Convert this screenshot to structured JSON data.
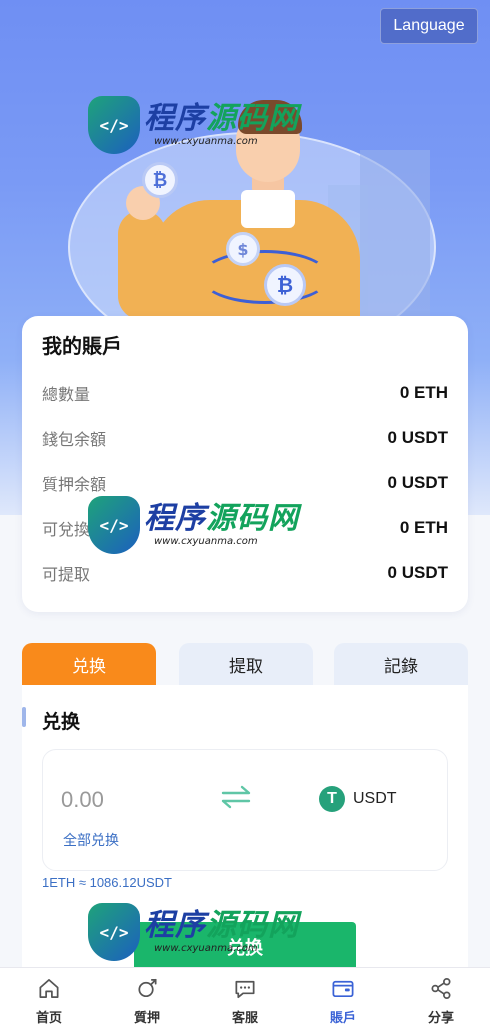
{
  "header": {
    "language_button": "Language"
  },
  "watermark": {
    "title_blue": "程序",
    "title_green": "源码网",
    "url": "www.cxyuanma.com"
  },
  "account": {
    "title": "我的賬戶",
    "rows": [
      {
        "label": "總數量",
        "value": "0 ETH"
      },
      {
        "label": "錢包余額",
        "value": "0 USDT"
      },
      {
        "label": "質押余額",
        "value": "0 USDT"
      },
      {
        "label": "可兌換",
        "value": "0 ETH"
      },
      {
        "label": "可提取",
        "value": "0 USDT"
      }
    ]
  },
  "tabs": [
    {
      "label": "兑换",
      "active": true
    },
    {
      "label": "提取",
      "active": false
    },
    {
      "label": "記錄",
      "active": false
    }
  ],
  "exchange": {
    "section_title": "兑换",
    "amount_placeholder": "0.00",
    "exchange_all": "全部兑换",
    "target_currency": "USDT",
    "rate": "1ETH ≈ 1086.12USDT",
    "submit_label": "兑换"
  },
  "bottom_nav": [
    {
      "label": "首页",
      "icon": "home-icon",
      "active": false
    },
    {
      "label": "質押",
      "icon": "pledge-icon",
      "active": false
    },
    {
      "label": "客服",
      "icon": "chat-icon",
      "active": false
    },
    {
      "label": "賬戶",
      "icon": "wallet-icon",
      "active": true
    },
    {
      "label": "分享",
      "icon": "share-icon",
      "active": false
    }
  ],
  "colors": {
    "accent_orange": "#f98a1b",
    "primary_green": "#1ab66b",
    "link_blue": "#3b6fc4",
    "nav_active": "#3a62d6",
    "usdt_green": "#26a17b"
  }
}
